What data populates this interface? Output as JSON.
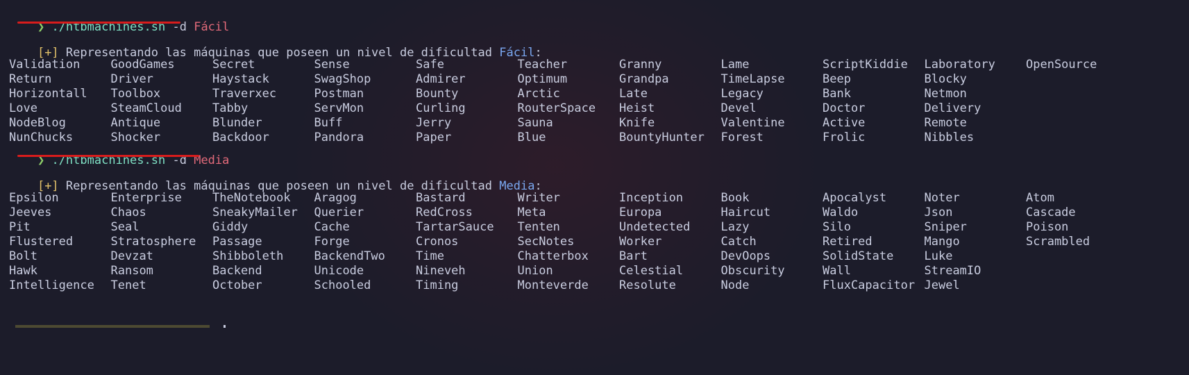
{
  "prompt_symbol": "❯",
  "commands": [
    {
      "script": "./htbmachines.sh",
      "flag": "-d",
      "arg": "Fácil"
    },
    {
      "script": "./htbmachines.sh",
      "flag": "-d",
      "arg": "Media"
    }
  ],
  "sections": [
    {
      "bracket": "[+]",
      "message": "Representando las máquinas que poseen un nivel de dificultad",
      "level": "Fácil",
      "suffix": ":",
      "rows": [
        [
          "Validation",
          "GoodGames",
          "Secret",
          "Sense",
          "Safe",
          "Teacher",
          "Granny",
          "Lame",
          "ScriptKiddie",
          "Laboratory",
          "OpenSource"
        ],
        [
          "Return",
          "Driver",
          "Haystack",
          "SwagShop",
          "Admirer",
          "Optimum",
          "Grandpa",
          "TimeLapse",
          "Beep",
          "Blocky",
          ""
        ],
        [
          "Horizontall",
          "Toolbox",
          "Traverxec",
          "Postman",
          "Bounty",
          "Arctic",
          "Late",
          "Legacy",
          "Bank",
          "Netmon",
          ""
        ],
        [
          "Love",
          "SteamCloud",
          "Tabby",
          "ServMon",
          "Curling",
          "RouterSpace",
          "Heist",
          "Devel",
          "Doctor",
          "Delivery",
          ""
        ],
        [
          "NodeBlog",
          "Antique",
          "Blunder",
          "Buff",
          "Jerry",
          "Sauna",
          "Knife",
          "Valentine",
          "Active",
          "Remote",
          ""
        ],
        [
          "NunChucks",
          "Shocker",
          "Backdoor",
          "Pandora",
          "Paper",
          "Blue",
          "BountyHunter",
          "Forest",
          "Frolic",
          "Nibbles",
          ""
        ]
      ]
    },
    {
      "bracket": "[+]",
      "message": "Representando las máquinas que poseen un nivel de dificultad",
      "level": "Media",
      "suffix": ":",
      "rows": [
        [
          "Epsilon",
          "Enterprise",
          "TheNotebook",
          "Aragog",
          "Bastard",
          "Writer",
          "Inception",
          "Book",
          "Apocalyst",
          "Noter",
          "Atom"
        ],
        [
          "Jeeves",
          "Chaos",
          "SneakyMailer",
          "Querier",
          "RedCross",
          "Meta",
          "Europa",
          "Haircut",
          "Waldo",
          "Json",
          "Cascade"
        ],
        [
          "Pit",
          "Seal",
          "Giddy",
          "Cache",
          "TartarSauce",
          "Tenten",
          "Undetected",
          "Lazy",
          "Silo",
          "Sniper",
          "Poison"
        ],
        [
          "Flustered",
          "Stratosphere",
          "Passage",
          "Forge",
          "Cronos",
          "SecNotes",
          "Worker",
          "Catch",
          "Retired",
          "Mango",
          "Scrambled"
        ],
        [
          "Bolt",
          "Devzat",
          "Shibboleth",
          "BackendTwo",
          "Time",
          "Chatterbox",
          "Bart",
          "DevOops",
          "SolidState",
          "Luke",
          ""
        ],
        [
          "Hawk",
          "Ransom",
          "Backend",
          "Unicode",
          "Nineveh",
          "Union",
          "Celestial",
          "Obscurity",
          "Wall",
          "StreamIO",
          ""
        ],
        [
          "Intelligence",
          "Tenet",
          "October",
          "Schooled",
          "Timing",
          "Monteverde",
          "Resolute",
          "Node",
          "FluxCapacitor",
          "Jewel",
          ""
        ]
      ]
    }
  ]
}
